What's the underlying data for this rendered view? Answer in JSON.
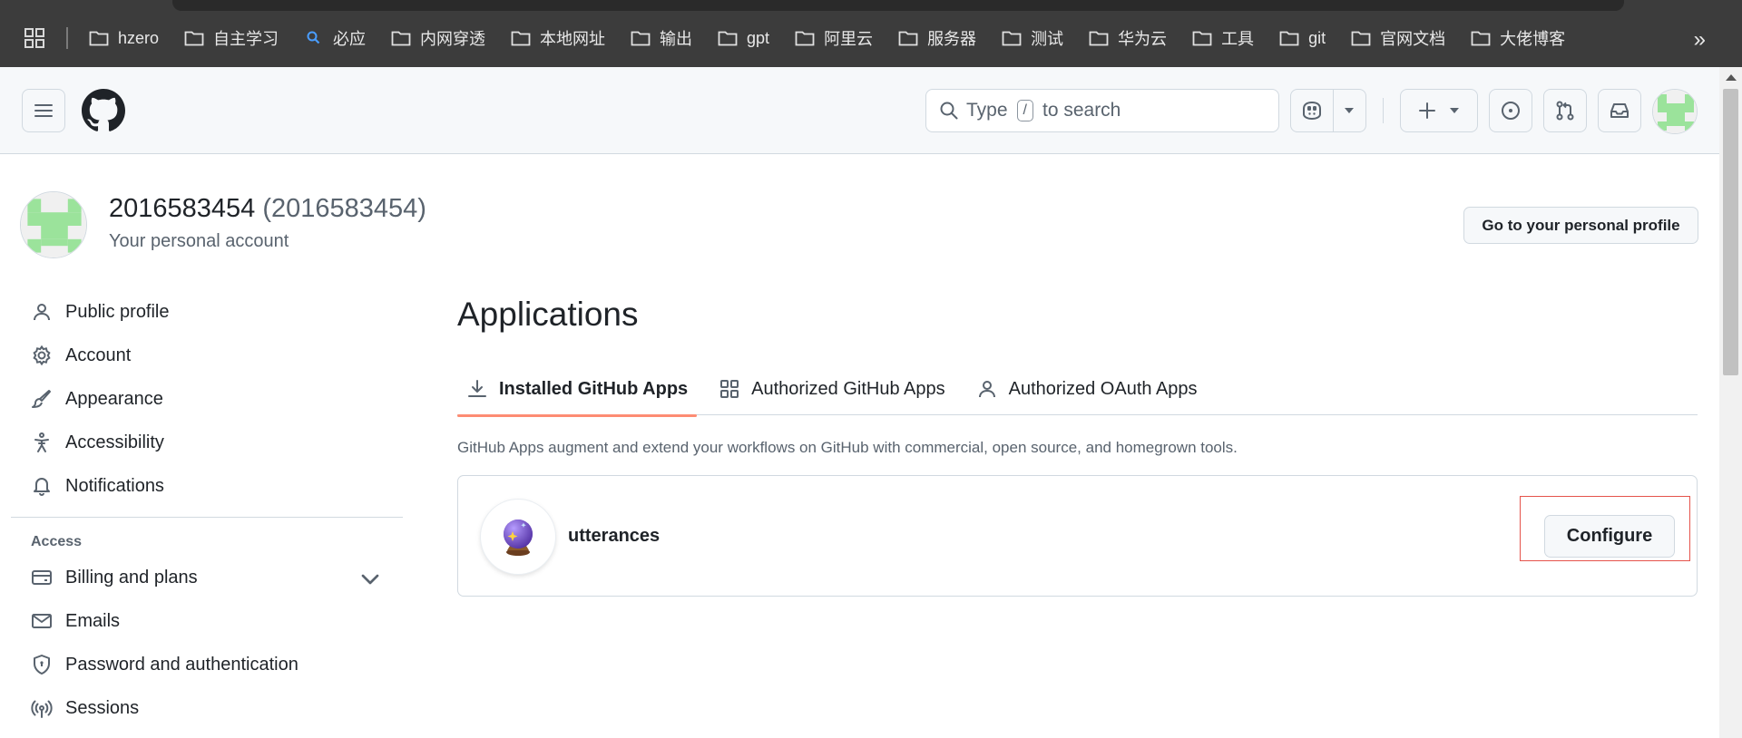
{
  "bookmarks": {
    "items": [
      {
        "label": "hzero",
        "icon": "folder-icon"
      },
      {
        "label": "自主学习",
        "icon": "folder-icon"
      },
      {
        "label": "必应",
        "icon": "bing-search-icon"
      },
      {
        "label": "内网穿透",
        "icon": "folder-icon"
      },
      {
        "label": "本地网址",
        "icon": "folder-icon"
      },
      {
        "label": "输出",
        "icon": "folder-icon"
      },
      {
        "label": "gpt",
        "icon": "folder-icon"
      },
      {
        "label": "阿里云",
        "icon": "folder-icon"
      },
      {
        "label": "服务器",
        "icon": "folder-icon"
      },
      {
        "label": "测试",
        "icon": "folder-icon"
      },
      {
        "label": "华为云",
        "icon": "folder-icon"
      },
      {
        "label": "工具",
        "icon": "folder-icon"
      },
      {
        "label": "git",
        "icon": "folder-icon"
      },
      {
        "label": "官网文档",
        "icon": "folder-icon"
      },
      {
        "label": "大佬博客",
        "icon": "folder-icon"
      }
    ],
    "more": "»"
  },
  "header": {
    "search_prefix": "Type",
    "search_key": "/",
    "search_suffix": "to search"
  },
  "account": {
    "name": "2016583454",
    "login": "(2016583454)",
    "subtitle": "Your personal account",
    "profile_button": "Go to your personal profile"
  },
  "sidebar": {
    "items": [
      {
        "label": "Public profile",
        "icon": "person-icon"
      },
      {
        "label": "Account",
        "icon": "gear-icon"
      },
      {
        "label": "Appearance",
        "icon": "paintbrush-icon"
      },
      {
        "label": "Accessibility",
        "icon": "accessibility-icon"
      },
      {
        "label": "Notifications",
        "icon": "bell-icon"
      }
    ],
    "access_heading": "Access",
    "access_items": [
      {
        "label": "Billing and plans",
        "icon": "credit-card-icon"
      },
      {
        "label": "Emails",
        "icon": "mail-icon"
      },
      {
        "label": "Password and authentication",
        "icon": "shield-lock-icon"
      },
      {
        "label": "Sessions",
        "icon": "broadcast-icon"
      }
    ]
  },
  "main": {
    "title": "Applications",
    "tabs": [
      {
        "label": "Installed GitHub Apps",
        "icon": "download-icon",
        "active": true
      },
      {
        "label": "Authorized GitHub Apps",
        "icon": "apps-icon",
        "active": false
      },
      {
        "label": "Authorized OAuth Apps",
        "icon": "person-icon",
        "active": false
      }
    ],
    "description": "GitHub Apps augment and extend your workflows on GitHub with commercial, open source, and homegrown tools.",
    "apps": [
      {
        "name": "utterances",
        "button": "Configure"
      }
    ]
  },
  "colors": {
    "bookmarks_bg": "#3c3c3c",
    "header_bg": "#f6f8fa",
    "tab_underline": "#fd8c73",
    "highlight_border": "#e5534b",
    "avatar_green": "#9be39b"
  }
}
